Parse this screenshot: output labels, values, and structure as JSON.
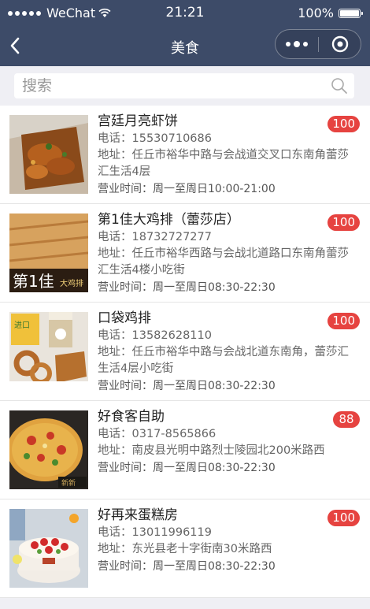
{
  "status_bar": {
    "carrier": "WeChat",
    "time": "21:21",
    "battery": "100%",
    "battery_level": 1.0
  },
  "nav": {
    "title": "美食"
  },
  "search": {
    "placeholder": "搜索"
  },
  "colors": {
    "nav_bg": "#3d4b68",
    "badge_bg": "#e64340",
    "page_bg": "#efeff4"
  },
  "items": [
    {
      "name": "宫廷月亮虾饼",
      "phone": "电话：15530710686",
      "address": "地址：任丘市裕华中路与会战道交叉口东南角蕾莎汇生活4层",
      "hours": "营业时间：周一至周日10:00-21:00",
      "badge": "100"
    },
    {
      "name": "第1佳大鸡排（蕾莎店）",
      "phone": "电话：18732727277",
      "address": "地址：任丘市裕华西路与会战北道路口东南角蕾莎汇生活4楼小吃街",
      "hours": "营业时间：周一至周日08:30-22:30",
      "badge": "100"
    },
    {
      "name": "口袋鸡排",
      "phone": "电话：13582628110",
      "address": "地址：任丘市裕华中路与会战北道东南角，蕾莎汇生活4层小吃街",
      "hours": "营业时间：周一至周日08:30-22:30",
      "badge": "100"
    },
    {
      "name": "好食客自助",
      "phone": "电话：0317-8565866",
      "address": "地址：南皮县光明中路烈士陵园北200米路西",
      "hours": "营业时间：周一至周日08:30-22:30",
      "badge": "88"
    },
    {
      "name": "好再来蛋糕房",
      "phone": "电话：13011996119",
      "address": "地址：东光县老十字街南30米路西",
      "hours": "营业时间：周一至周日08:30-22:30",
      "badge": "100"
    }
  ]
}
